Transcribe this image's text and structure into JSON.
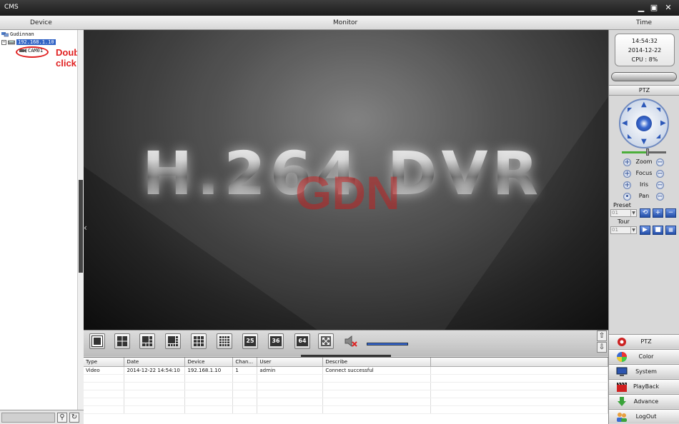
{
  "window": {
    "title": "CMS",
    "min": "▁",
    "max": "▣",
    "close": "✕"
  },
  "header": {
    "device": "Device",
    "monitor": "Monitor",
    "time": "Time"
  },
  "tree": {
    "root": "Gudinnan",
    "device": "192.168.1.10",
    "camera": "CAM01",
    "annotation": "Double click"
  },
  "search": {
    "value": "",
    "search_icon": "⚲",
    "refresh_icon": "↻"
  },
  "video": {
    "logo_text": "H.264 DVR",
    "watermark": "GDN"
  },
  "layout_buttons": [
    {
      "name": "layout-1",
      "label": ""
    },
    {
      "name": "layout-4",
      "label": ""
    },
    {
      "name": "layout-6",
      "label": ""
    },
    {
      "name": "layout-8",
      "label": ""
    },
    {
      "name": "layout-9",
      "label": ""
    },
    {
      "name": "layout-16",
      "label": ""
    },
    {
      "name": "layout-25",
      "label": "25"
    },
    {
      "name": "layout-36",
      "label": "36"
    },
    {
      "name": "layout-64",
      "label": "64"
    }
  ],
  "log": {
    "columns": [
      "Type",
      "Date",
      "Device",
      "Chan...",
      "User",
      "Describe"
    ],
    "rows": [
      [
        "Video",
        "2014-12-22 14:54:10",
        "192.168.1.10",
        "1",
        "admin",
        "Connect successful"
      ]
    ]
  },
  "clock": {
    "time": "14:54:32",
    "date": "2014-12-22",
    "cpu": "CPU : 8%"
  },
  "ptz": {
    "title": "PTZ",
    "zoom": "Zoom",
    "focus": "Focus",
    "iris": "Iris",
    "pan": "Pan",
    "preset_label": "Preset",
    "preset_value": "01",
    "tour_label": "Tour",
    "tour_value": "01"
  },
  "menu": {
    "ptz": "PTZ",
    "color": "Color",
    "system": "System",
    "playback": "PlayBack",
    "advance": "Advance",
    "logout": "LogOut"
  }
}
